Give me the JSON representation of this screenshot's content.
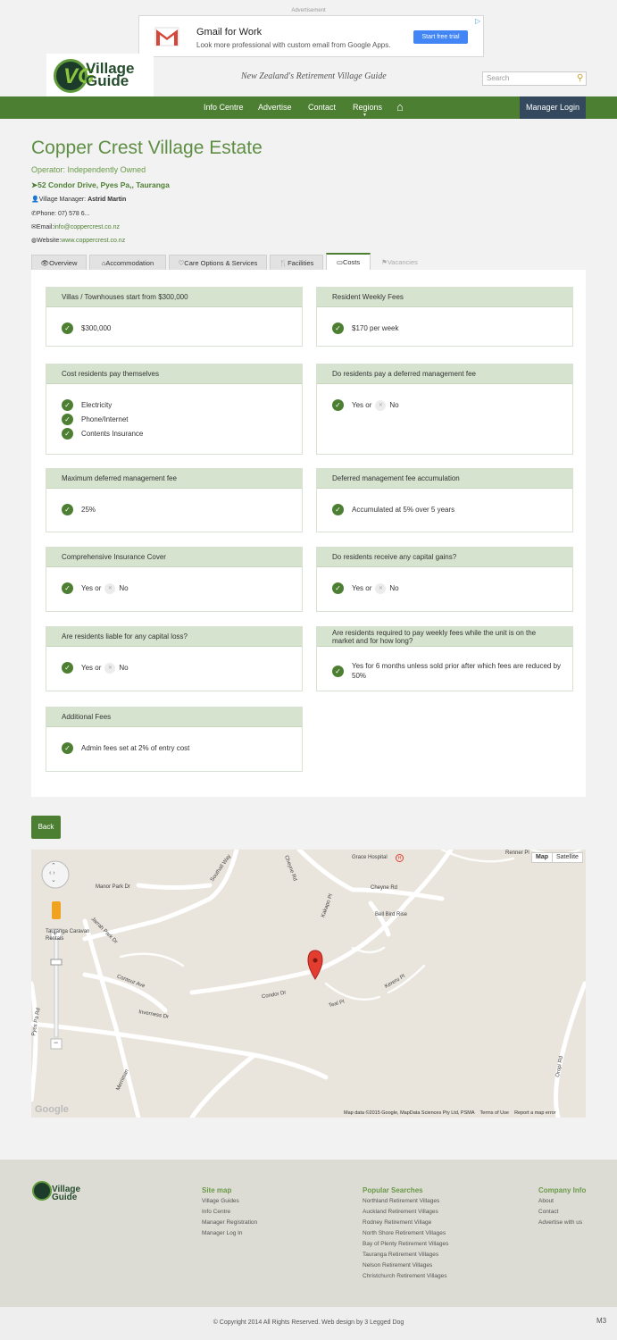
{
  "ad": {
    "label": "Advertisement",
    "title": "Gmail for Work",
    "subtitle": "Look more professional with custom email from Google Apps.",
    "cta": "Start free trial"
  },
  "header": {
    "logo_line1": "Village",
    "logo_line2": "Guide",
    "logo_mark": "VG",
    "tagline": "New Zealand's Retirement Village Guide",
    "search_placeholder": "Search"
  },
  "nav": {
    "items": [
      "Info Centre",
      "Advertise",
      "Contact",
      "Regions"
    ],
    "manager_login": "Manager Login"
  },
  "village": {
    "name": "Copper Crest Village Estate",
    "operator": "Operator: Independently Owned",
    "address": "52 Condor Drive, Pyes Pa,, Tauranga",
    "manager_label": "Village Manager:",
    "manager_name": "Astrid Martin",
    "phone": "Phone: 07) 578 6...",
    "email_label": "Email:",
    "email": "info@coppercrest.co.nz",
    "website_label": "Website:",
    "website": "www.coppercrest.co.nz"
  },
  "tabs": [
    "Overview",
    "Accommodation",
    "Care Options & Services",
    "Facilities",
    "Costs",
    "Vacancies"
  ],
  "cards": {
    "villas": {
      "title": "Villas / Townhouses start from $300,000",
      "items": [
        "$300,000"
      ]
    },
    "weekly": {
      "title": "Resident Weekly Fees",
      "items": [
        "$170 per week"
      ]
    },
    "self_pay": {
      "title": "Cost residents pay themselves",
      "items": [
        "Electricity",
        "Phone/Internet",
        "Contents Insurance"
      ]
    },
    "deferred": {
      "title": "Do residents pay a deferred management fee",
      "yes": "Yes or",
      "no": "No"
    },
    "max_fee": {
      "title": "Maximum deferred management fee",
      "items": [
        "25%"
      ]
    },
    "accum": {
      "title": "Deferred management fee accumulation",
      "items": [
        "Accumulated at 5% over 5 years"
      ]
    },
    "insurance": {
      "title": "Comprehensive Insurance Cover",
      "yes": "Yes or",
      "no": "No"
    },
    "gains": {
      "title": "Do residents receive any capital gains?",
      "yes": "Yes or",
      "no": "No"
    },
    "loss": {
      "title": "Are residents liable for any capital loss?",
      "yes": "Yes or",
      "no": "No"
    },
    "weekly_market": {
      "title": "Are residents required to pay weekly fees while the unit is on the market and for how long?",
      "items": [
        "Yes for 6 months unless sold prior after which fees are reduced by 50%"
      ]
    },
    "additional": {
      "title": "Additional Fees",
      "items": [
        "Admin fees set at 2% of entry cost"
      ]
    }
  },
  "back_label": "Back",
  "map": {
    "type_map": "Map",
    "type_satellite": "Satellite",
    "labels": [
      "Grace Hospital",
      "Renner Pl",
      "Cheyne Rd",
      "Southall Way",
      "Manor Park Dr",
      "Tauranga Caravan Rentals",
      "Jarrah Park Dr",
      "Bell Bird Rise",
      "Kakapo Pl",
      "Contour Ave",
      "Condor Dr",
      "Kereru Pl",
      "Teal Pl",
      "Inverness Dr",
      "Pyes Pa Rd",
      "Merriman",
      "Oropi Rd"
    ],
    "google": "Google",
    "attribution": "Map data ©2015 Google, MapData Sciences Pty Ltd, PSMA",
    "terms": "Terms of Use",
    "report": "Report a map error"
  },
  "footer": {
    "sitemap_title": "Site map",
    "sitemap": [
      "Village Guides",
      "Info Centre",
      "Manager Registration",
      "Manager Log In"
    ],
    "popular_title": "Popular Searches",
    "popular": [
      "Northland Retirement Villages",
      "Auckland Retirement Villages",
      "Rodney Retirement Village",
      "North Shore Retirement Villages",
      "Bay of Plenty Retirement Villages",
      "Tauranga Retirement Villages",
      "Nelson Retirement Villages",
      "Christchurch Retirement Villages"
    ],
    "company_title": "Company Info",
    "company": [
      "About",
      "Contact",
      "Advertise with us"
    ],
    "copyright": "© Copyright 2014 All Rights Reserved. Web design by 3 Legged Dog",
    "badge": "M3"
  },
  "colors": {
    "brand_green": "#4d7f32",
    "card_head": "#d6e4cf",
    "manager_login_bg": "#34495e"
  }
}
